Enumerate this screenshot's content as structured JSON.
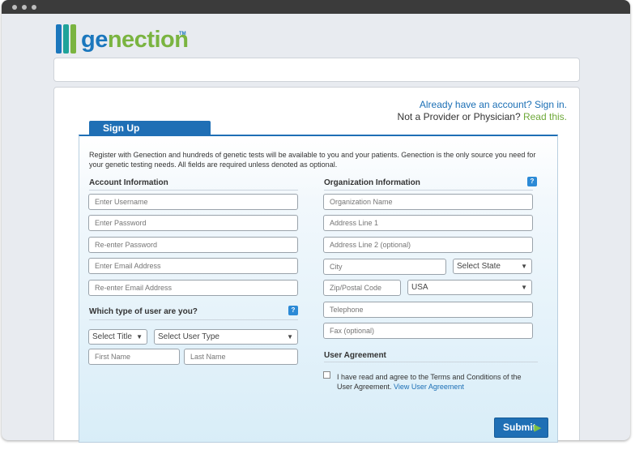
{
  "brand": {
    "logo_part1": "ge",
    "logo_part2": "nection",
    "tm": "TM",
    "colors": {
      "blue": "#1b77bd",
      "green": "#7ab440",
      "teal": "#1fa39a"
    }
  },
  "header_links": {
    "already": "Already have an account? Sign in.",
    "provider_prefix": "Not a Provider or Physician?",
    "provider_link": "Read this."
  },
  "tab": {
    "label": "Sign Up"
  },
  "intro": "Register with Genection and hundreds of genetic tests will be available to you and your patients. Genection is the only source you need for your genetic testing needs. All fields are required unless denoted as optional.",
  "account": {
    "title": "Account Information",
    "fields": [
      "Enter Username",
      "Enter Password",
      "Re-enter Password",
      "Enter Email Address",
      "Re-enter Email Address"
    ]
  },
  "user_type": {
    "title": "Which type of user are you?",
    "help": "?",
    "select_title": "Select Title",
    "select_user_type": "Select User Type",
    "first_name": "First Name",
    "last_name": "Last Name"
  },
  "organization": {
    "title": "Organization Information",
    "help": "?",
    "org_name": "Organization Name",
    "address1": "Address Line 1",
    "address2": "Address Line 2 (optional)",
    "city": "City",
    "state": "Select State",
    "zip": "Zip/Postal Code",
    "country": "USA",
    "telephone": "Telephone",
    "fax": "Fax (optional)"
  },
  "agreement": {
    "title": "User Agreement",
    "text": "I have read and agree to the Terms and Conditions of the User Agreement.",
    "link": "View User Agreement"
  },
  "submit": {
    "label": "Submit",
    "icon": "play-icon"
  },
  "arrow_glyph": "▼",
  "play_glyph": "▶"
}
